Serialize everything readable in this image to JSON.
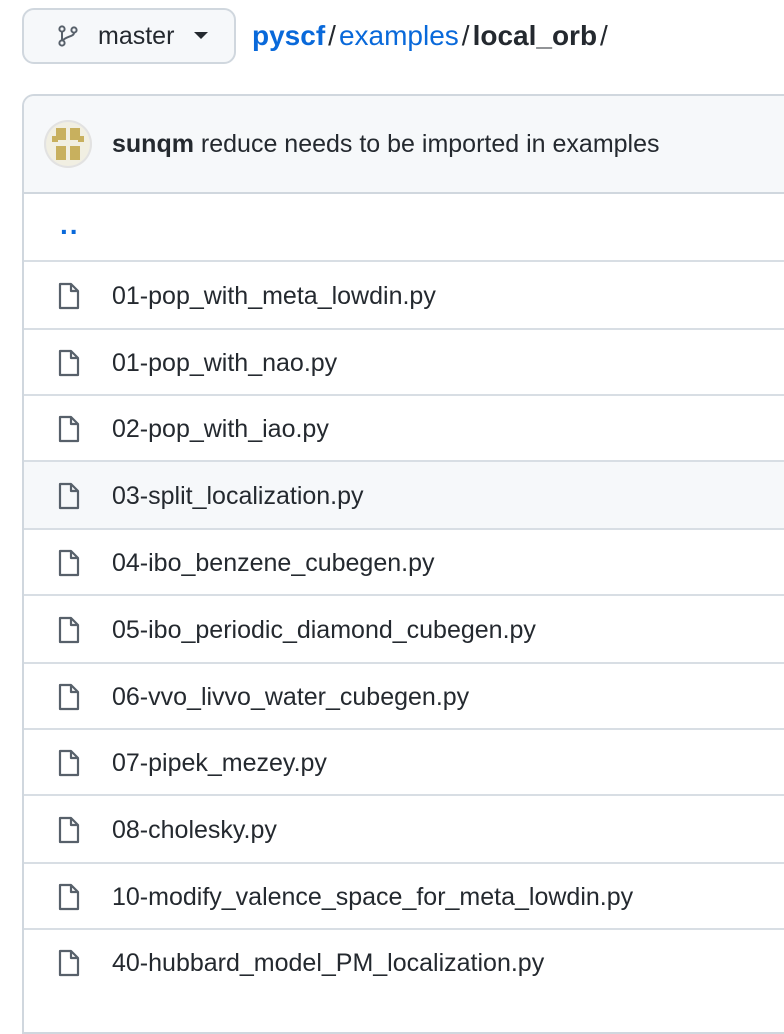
{
  "branch": {
    "label": "master",
    "icon": "git-branch-icon",
    "dropdown_icon": "caret-down-icon"
  },
  "breadcrumb": {
    "repo": "pyscf",
    "sep1": "/",
    "folder": "examples",
    "sep2": "/",
    "current": "local_orb",
    "sep3": "/"
  },
  "commit": {
    "author": "sunqm",
    "message": "reduce needs to be imported in examples"
  },
  "parent": {
    "label": ".."
  },
  "files": [
    {
      "name": "01-pop_with_meta_lowdin.py",
      "icon": "file-icon"
    },
    {
      "name": "01-pop_with_nao.py",
      "icon": "file-icon"
    },
    {
      "name": "02-pop_with_iao.py",
      "icon": "file-icon"
    },
    {
      "name": "03-split_localization.py",
      "icon": "file-icon"
    },
    {
      "name": "04-ibo_benzene_cubegen.py",
      "icon": "file-icon"
    },
    {
      "name": "05-ibo_periodic_diamond_cubegen.py",
      "icon": "file-icon"
    },
    {
      "name": "06-vvo_livvo_water_cubegen.py",
      "icon": "file-icon"
    },
    {
      "name": "07-pipek_mezey.py",
      "icon": "file-icon"
    },
    {
      "name": "08-cholesky.py",
      "icon": "file-icon"
    },
    {
      "name": "10-modify_valence_space_for_meta_lowdin.py",
      "icon": "file-icon"
    },
    {
      "name": "40-hubbard_model_PM_localization.py",
      "icon": "file-icon"
    }
  ],
  "colors": {
    "link": "#0969da",
    "text": "#24292f",
    "border": "#d0d7de",
    "header_bg": "#f6f8fa",
    "avatar_gold": "#c8b05e"
  }
}
